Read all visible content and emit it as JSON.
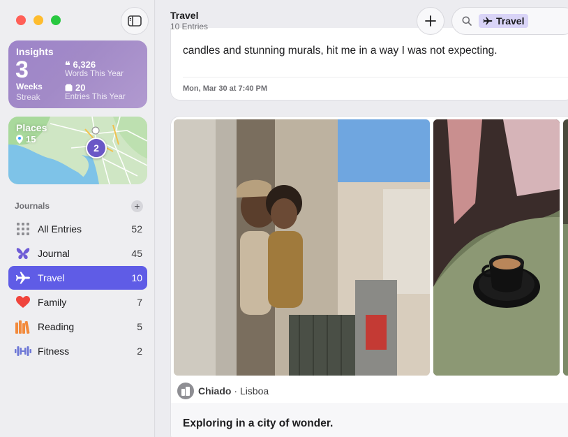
{
  "sidebar": {
    "insights": {
      "title": "Insights",
      "streak_value": "3",
      "streak_unit": "Weeks",
      "streak_label": "Streak",
      "words_value": "6,326",
      "words_label": "Words This Year",
      "entries_value": "20",
      "entries_label": "Entries This Year"
    },
    "places": {
      "title": "Places",
      "count": "15",
      "map_pin_count": "2"
    },
    "section_title": "Journals",
    "items": [
      {
        "label": "All Entries",
        "count": "52",
        "icon": "grid-icon"
      },
      {
        "label": "Journal",
        "count": "45",
        "icon": "butterfly-icon"
      },
      {
        "label": "Travel",
        "count": "10",
        "icon": "airplane-icon",
        "active": true
      },
      {
        "label": "Family",
        "count": "7",
        "icon": "heart-icon"
      },
      {
        "label": "Reading",
        "count": "5",
        "icon": "books-icon"
      },
      {
        "label": "Fitness",
        "count": "2",
        "icon": "dumbbell-icon"
      }
    ]
  },
  "toolbar": {
    "title": "Travel",
    "subtitle": "10 Entries",
    "search_token": "Travel"
  },
  "entries": [
    {
      "text": "candles and stunning murals, hit me in a way I was not expecting.",
      "date": "Mon, Mar 30 at 7:40 PM"
    },
    {
      "location_name": "Chiado",
      "location_city": "Lisboa",
      "separator": " · ",
      "title": "Exploring in a city of wonder."
    }
  ],
  "colors": {
    "accent": "#5f5ce6",
    "insights": "#a28ac7",
    "traffic_red": "#ff5f57",
    "traffic_yellow": "#febc2e",
    "traffic_green": "#28c840"
  }
}
